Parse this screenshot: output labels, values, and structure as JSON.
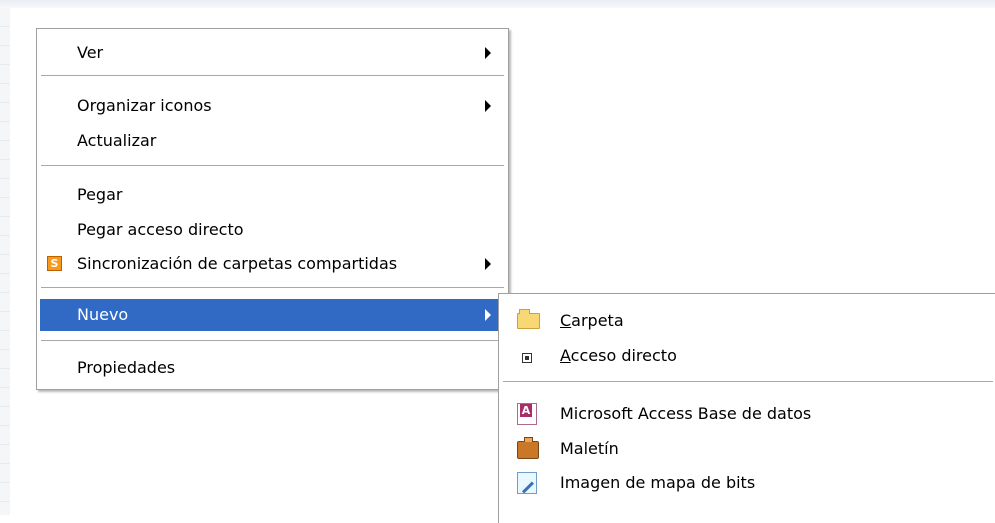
{
  "main_menu": {
    "items": [
      {
        "label": "Ver",
        "has_submenu": true
      },
      {
        "label": "Organizar iconos",
        "has_submenu": true
      },
      {
        "label": "Actualizar",
        "has_submenu": false
      },
      {
        "label": "Pegar",
        "has_submenu": false
      },
      {
        "label": "Pegar acceso directo",
        "has_submenu": false
      },
      {
        "label": "Sincronización de carpetas compartidas",
        "has_submenu": true,
        "icon": "sync-icon"
      },
      {
        "label": "Nuevo",
        "has_submenu": true,
        "highlighted": true
      },
      {
        "label": "Propiedades",
        "has_submenu": false
      }
    ],
    "sync_icon_letter": "S"
  },
  "sub_menu": {
    "items": [
      {
        "label_first": "C",
        "label_rest": "arpeta",
        "icon": "folder-icon"
      },
      {
        "label_first": "A",
        "label_rest": "cceso directo",
        "icon": "shortcut-icon"
      },
      {
        "label": "Microsoft Access Base de datos",
        "icon": "access-icon"
      },
      {
        "label": "Maletín",
        "icon": "briefcase-icon"
      },
      {
        "label": "Imagen de mapa de bits",
        "icon": "bitmap-icon"
      }
    ]
  },
  "colors": {
    "highlight": "#316ac5",
    "menu_border": "#a0a0a0"
  }
}
